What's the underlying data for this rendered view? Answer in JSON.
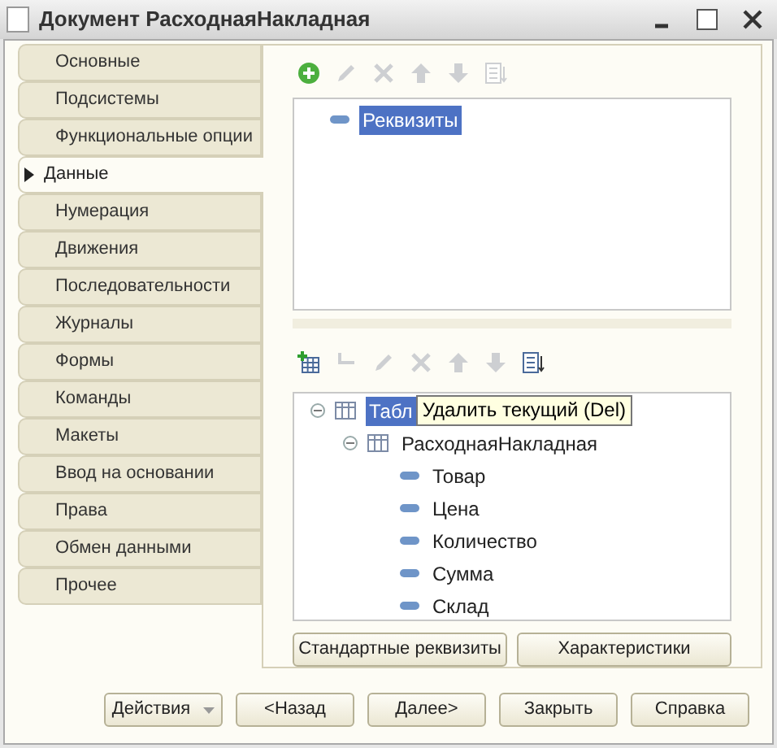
{
  "window": {
    "title": "Документ РасходнаяНакладная"
  },
  "tabs": [
    {
      "label": "Основные",
      "selected": false
    },
    {
      "label": "Подсистемы",
      "selected": false
    },
    {
      "label": "Функциональные опции",
      "selected": false
    },
    {
      "label": "Данные",
      "selected": true
    },
    {
      "label": "Нумерация",
      "selected": false
    },
    {
      "label": "Движения",
      "selected": false
    },
    {
      "label": "Последовательности",
      "selected": false
    },
    {
      "label": "Журналы",
      "selected": false
    },
    {
      "label": "Формы",
      "selected": false
    },
    {
      "label": "Команды",
      "selected": false
    },
    {
      "label": "Макеты",
      "selected": false
    },
    {
      "label": "Ввод на основании",
      "selected": false
    },
    {
      "label": "Права",
      "selected": false
    },
    {
      "label": "Обмен данными",
      "selected": false
    },
    {
      "label": "Прочее",
      "selected": false
    }
  ],
  "attributes_toolbar": [
    {
      "kind": "add",
      "disabled": false
    },
    {
      "kind": "edit",
      "disabled": true
    },
    {
      "kind": "delete",
      "disabled": true
    },
    {
      "kind": "up",
      "disabled": true
    },
    {
      "kind": "down",
      "disabled": true
    },
    {
      "kind": "sort",
      "disabled": true
    }
  ],
  "attributes_tree": [
    {
      "kind": "attribute",
      "label": "Реквизиты",
      "selected": true
    }
  ],
  "tables_toolbar": [
    {
      "kind": "add-table",
      "disabled": false
    },
    {
      "kind": "add-child",
      "disabled": true
    },
    {
      "kind": "edit",
      "disabled": true
    },
    {
      "kind": "delete",
      "disabled": true
    },
    {
      "kind": "up",
      "disabled": true
    },
    {
      "kind": "down",
      "disabled": true
    },
    {
      "kind": "sort",
      "disabled": false
    }
  ],
  "tables_tree": [
    {
      "kind": "table",
      "label": "Табл",
      "selected": true,
      "expanded": true,
      "children": [
        {
          "kind": "table",
          "label": "РасходнаяНакладная",
          "selected": false,
          "expanded": true,
          "children": [
            {
              "kind": "attribute",
              "label": "Товар",
              "selected": false
            },
            {
              "kind": "attribute",
              "label": "Цена",
              "selected": false
            },
            {
              "kind": "attribute",
              "label": "Количество",
              "selected": false
            },
            {
              "kind": "attribute",
              "label": "Сумма",
              "selected": false
            },
            {
              "kind": "attribute",
              "label": "Склад",
              "selected": false
            }
          ]
        }
      ]
    }
  ],
  "tooltip": "Удалить текущий (Del)",
  "panel_buttons": [
    "Стандартные реквизиты",
    "Характеристики"
  ],
  "footer_buttons": [
    {
      "label": "Действия",
      "kind": "menu"
    },
    {
      "label": "<Назад",
      "kind": "plain"
    },
    {
      "label": "Далее>",
      "kind": "plain"
    },
    {
      "label": "Закрыть",
      "kind": "plain"
    },
    {
      "label": "Справка",
      "kind": "plain"
    }
  ]
}
